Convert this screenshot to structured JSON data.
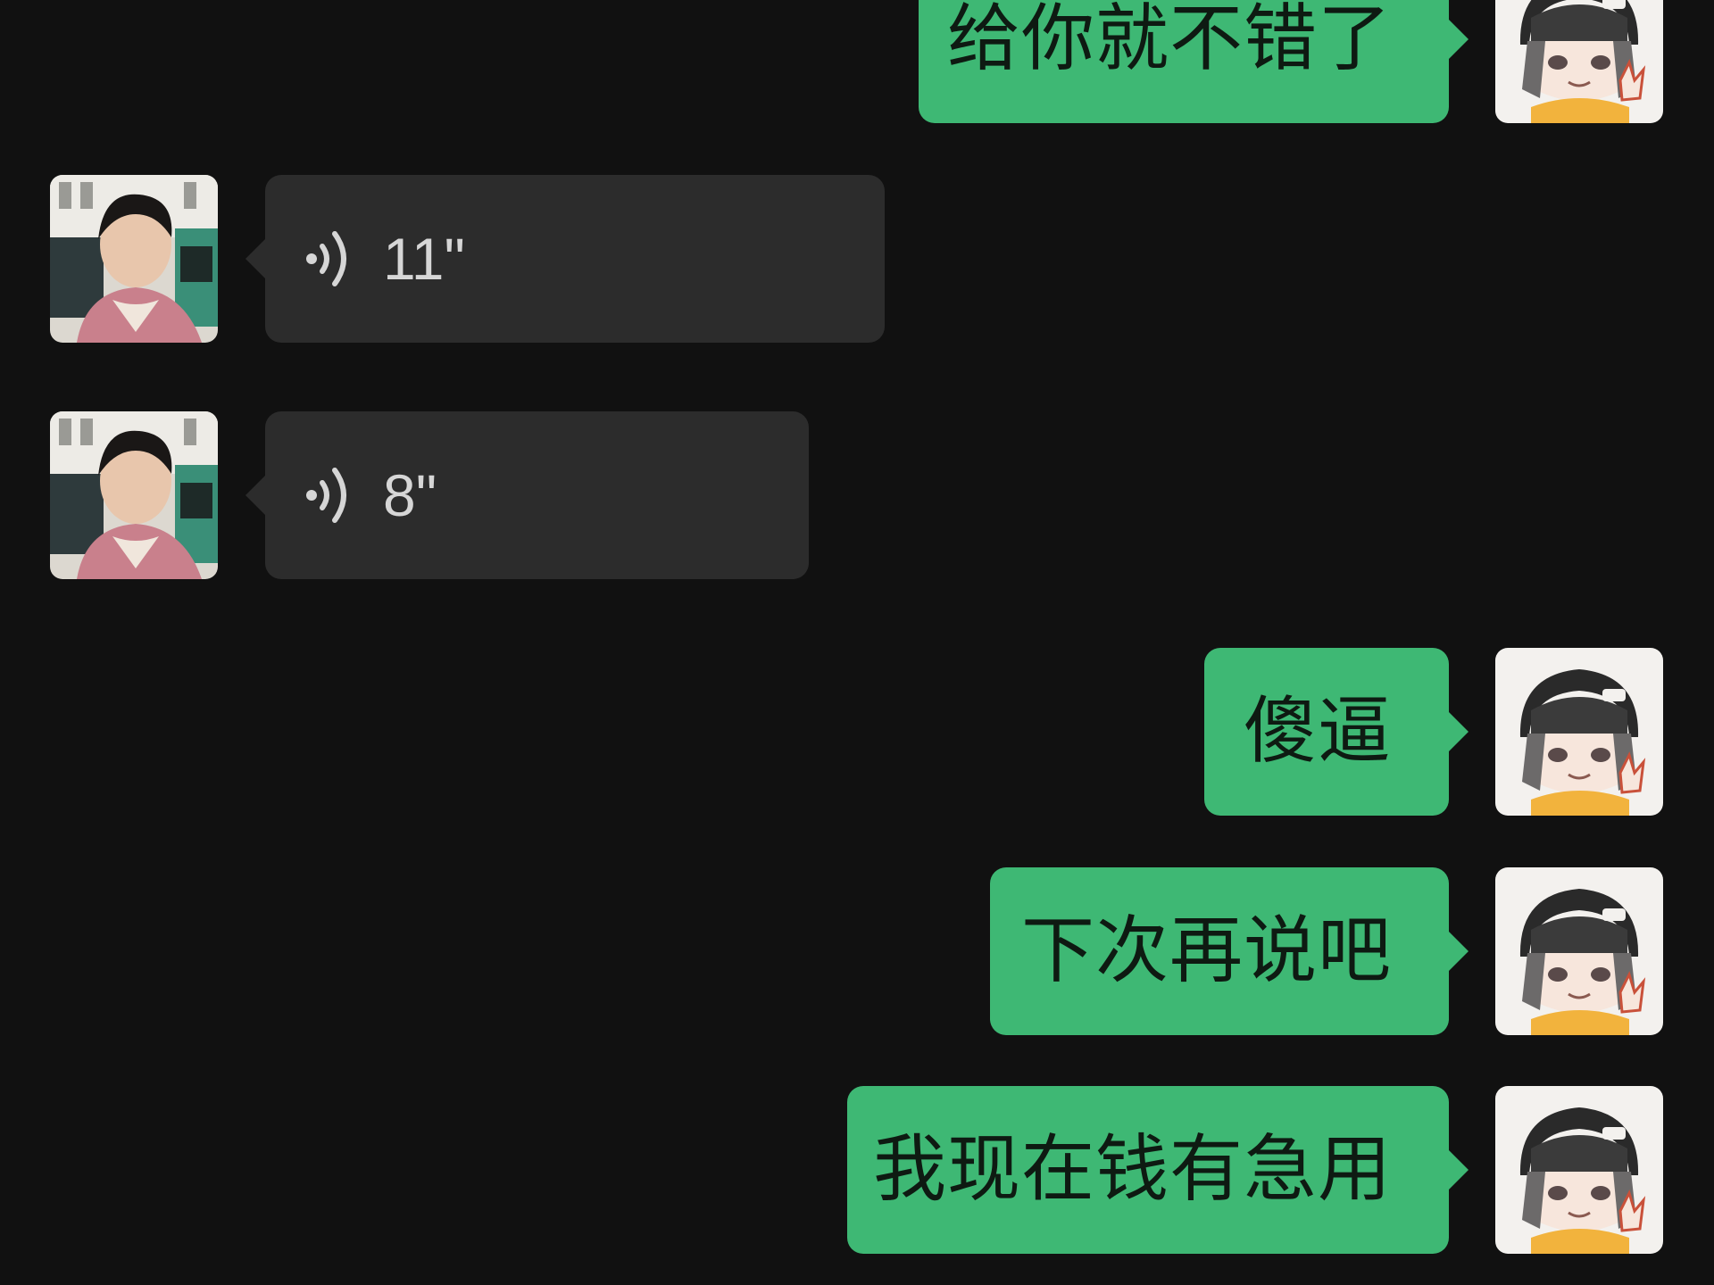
{
  "messages": [
    {
      "sender": "self",
      "type": "text",
      "text": "给你就不错了"
    },
    {
      "sender": "other",
      "type": "voice",
      "duration": "11\""
    },
    {
      "sender": "other",
      "type": "voice",
      "duration": "8\""
    },
    {
      "sender": "self",
      "type": "text",
      "text": "傻逼"
    },
    {
      "sender": "self",
      "type": "text",
      "text": "下次再说吧"
    },
    {
      "sender": "self",
      "type": "text",
      "text": "我现在钱有急用"
    }
  ],
  "colors": {
    "background": "#111111",
    "self_bubble": "#3EB874",
    "other_bubble": "#2C2C2C",
    "self_text": "#0E1A12",
    "voice_text": "#D6D6D6"
  },
  "icons": {
    "voice": "voice-wave-icon",
    "self_avatar": "anime-girl-avatar",
    "other_avatar": "man-photo-avatar"
  }
}
